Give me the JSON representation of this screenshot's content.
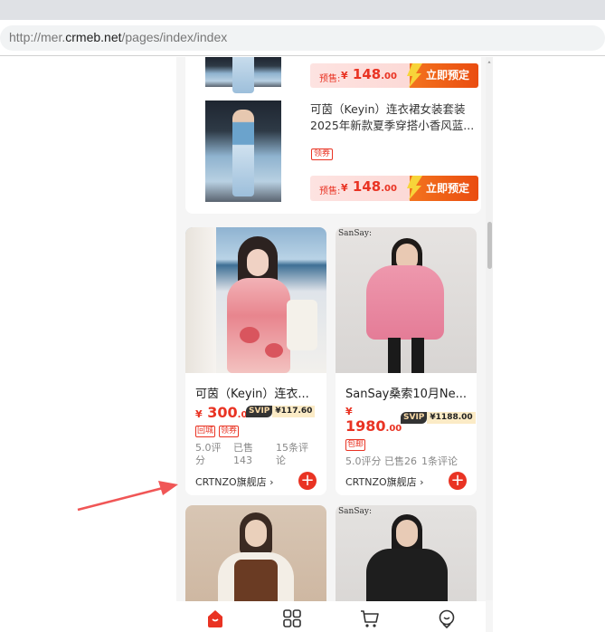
{
  "browser": {
    "url_prefix": "http://mer.",
    "url_domain": "crmeb.net",
    "url_path": "/pages/index/index"
  },
  "presale_list": [
    {
      "title": "",
      "price_label": "预售:",
      "price_symbol": "¥",
      "price_int": "148",
      "price_dec": ".00",
      "button": "立即预定"
    },
    {
      "title": "可茵（Keyin）连衣裙女装套装2025年新款夏季穿搭小香风蓝...",
      "coupon": "领券",
      "price_label": "预售:",
      "price_symbol": "¥",
      "price_int": "148",
      "price_dec": ".00",
      "button": "立即预定"
    }
  ],
  "products": [
    {
      "title": "可茵（Keyin）连衣...",
      "price_symbol": "¥",
      "price_int": "300",
      "price_dec": ".00",
      "svip_label": "SVIP",
      "svip_price": "¥117.60",
      "tags": [
        "回城",
        "领券"
      ],
      "rating_a": "5.0评",
      "rating_b": "分",
      "sold_a": "已售",
      "sold_b": "143",
      "reviews_a": "15条评",
      "reviews_b": "论",
      "store": "CRTNZO旗舰店",
      "chevron": "›"
    },
    {
      "title": "SanSay桑索10月Ne...",
      "price_symbol": "¥",
      "price_int": "1980",
      "price_dec": ".00",
      "svip_label": "SVIP",
      "svip_price": "¥1188.00",
      "tags": [
        "包邮"
      ],
      "rating": "5.0评分",
      "sold": "已售26",
      "reviews": "1条评论",
      "store": "CRTNZO旗舰店",
      "chevron": "›",
      "brand_mark": "SanSay:"
    },
    {
      "brand_mark": "SanSay:"
    }
  ],
  "colors": {
    "accent": "#e93323",
    "annotation_arrow": "#f05656"
  },
  "icons": [
    "add-icon",
    "home-icon",
    "category-icon",
    "cart-icon",
    "profile-icon",
    "lightning-icon"
  ]
}
